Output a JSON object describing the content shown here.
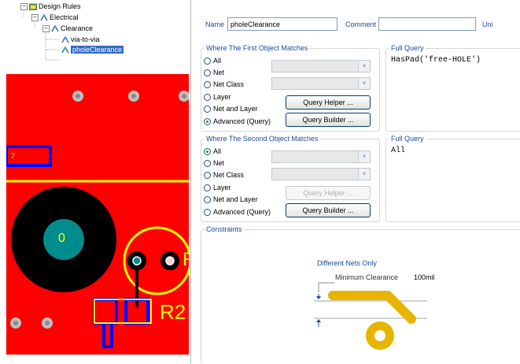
{
  "tree": {
    "design_rules": "Design Rules",
    "electrical": "Electrical",
    "clearance": "Clearance",
    "via_to_via": "via-to-via",
    "phole_clearance": "pholeClearance"
  },
  "pcb": {
    "pad_label": "0",
    "small_label": "7",
    "designator": "R2",
    "partial_r": "R"
  },
  "rule": {
    "name_label": "Name",
    "name_value": "pholeClearance",
    "comment_label": "Comment",
    "comment_value": "",
    "unique_label": "Uni"
  },
  "first_match": {
    "title": "Where The First Object Matches",
    "options": [
      "All",
      "Net",
      "Net Class",
      "Layer",
      "Net and Layer",
      "Advanced (Query)"
    ],
    "selected": "Advanced (Query)",
    "query_helper": "Query Helper ...",
    "query_builder": "Query Builder ...",
    "full_query_title": "Full Query",
    "full_query": "HasPad('free-HOLE')"
  },
  "second_match": {
    "title": "Where The Second Object Matches",
    "options": [
      "All",
      "Net",
      "Net Class",
      "Layer",
      "Net and Layer",
      "Advanced (Query)"
    ],
    "selected": "All",
    "query_helper": "Query Helper ...",
    "query_builder": "Query Builder ...",
    "full_query_title": "Full Query",
    "full_query": "All"
  },
  "constraints": {
    "title": "Constraints",
    "different_nets": "Different Nets Only",
    "min_clearance_label": "Minimum Clearance",
    "min_clearance_value": "100mil"
  },
  "colors": {
    "pcb_red": "#ff0000",
    "pcb_yellow": "#ffff00",
    "pad_teal": "#008c8c",
    "track_gold": "#e8b400"
  }
}
